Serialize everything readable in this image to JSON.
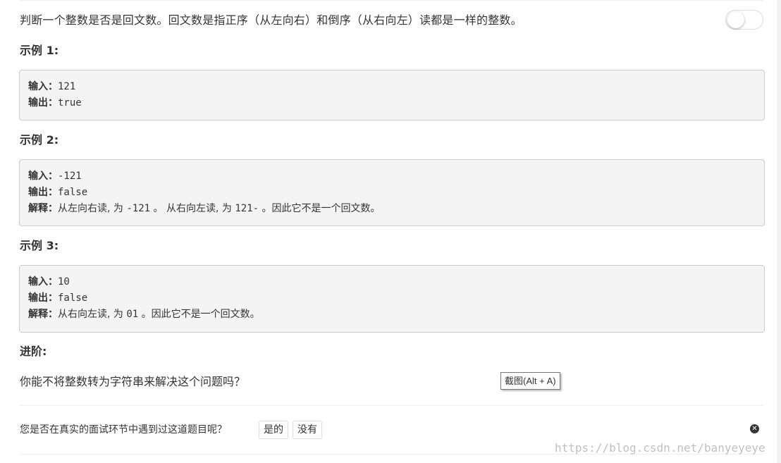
{
  "description": "判断一个整数是否是回文数。回文数是指正序（从左向右）和倒序（从右向左）读都是一样的整数。",
  "examples": [
    {
      "heading": "示例 1:",
      "lines": [
        {
          "label": "输入：",
          "value": "121"
        },
        {
          "label": "输出：",
          "value": "true"
        }
      ]
    },
    {
      "heading": "示例 2:",
      "lines": [
        {
          "label": "输入：",
          "value": "-121"
        },
        {
          "label": "输出：",
          "value": "false"
        },
        {
          "label": "解释：",
          "text1": "从左向右读, 为 ",
          "code1": "-121",
          "text2": " 。 从右向左读, 为 ",
          "code2": "121-",
          "text3": " 。因此它不是一个回文数。"
        }
      ]
    },
    {
      "heading": "示例 3:",
      "lines": [
        {
          "label": "输入：",
          "value": "10"
        },
        {
          "label": "输出：",
          "value": "false"
        },
        {
          "label": "解释：",
          "text1": "从右向左读, 为 ",
          "code1": "01",
          "text2": " 。因此它不是一个回文数。"
        }
      ]
    }
  ],
  "advanced": {
    "heading": "进阶:",
    "text": "你能不将整数转为字符串来解决这个问题吗？"
  },
  "screenshot_tooltip": "截图(Alt + A)",
  "survey": {
    "question": "您是否在真实的面试环节中遇到过这道题目呢？",
    "yes_label": "是的",
    "no_label": "没有"
  },
  "watermark": "https://blog.csdn.net/banyeyeye",
  "toggle": {
    "state": "off"
  }
}
